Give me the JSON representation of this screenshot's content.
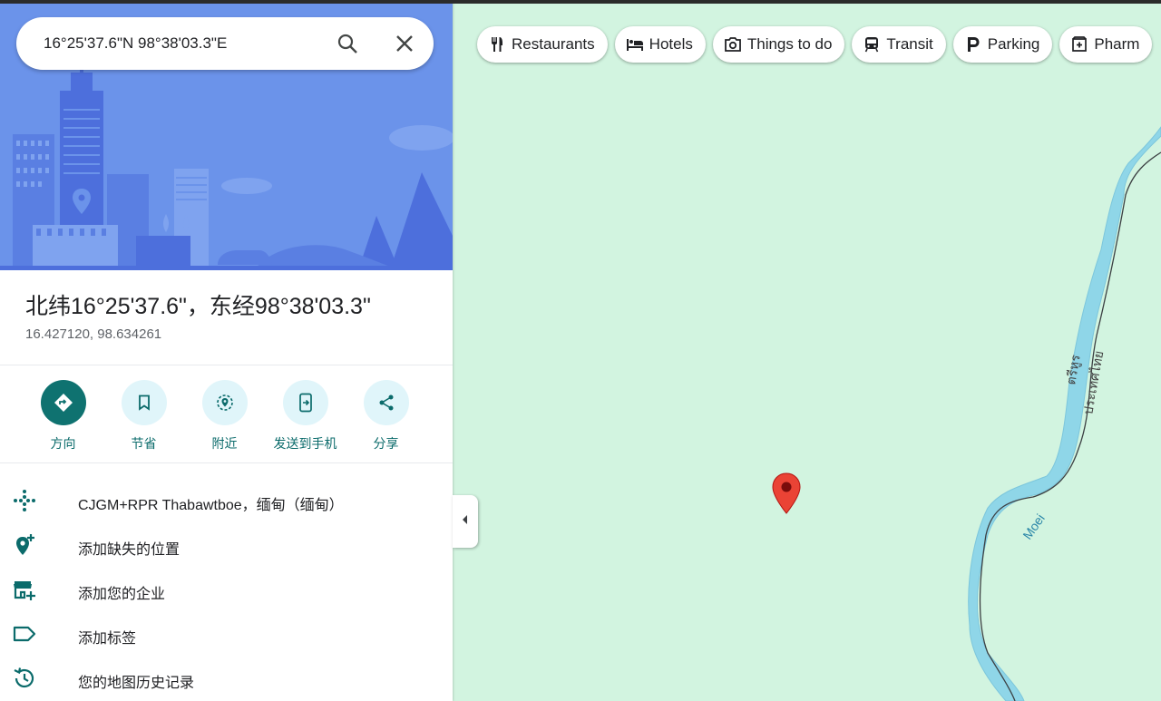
{
  "search": {
    "value": "16°25'37.6\"N 98°38'03.3\"E"
  },
  "place": {
    "title": "北纬16°25'37.6\"，东经98°38'03.3\"",
    "coords": "16.427120, 98.634261"
  },
  "actions": [
    {
      "label": "方向",
      "icon": "directions-icon"
    },
    {
      "label": "节省",
      "icon": "bookmark-icon"
    },
    {
      "label": "附近",
      "icon": "nearby-icon"
    },
    {
      "label": "发送到手机",
      "icon": "send-to-phone-icon"
    },
    {
      "label": "分享",
      "icon": "share-icon"
    }
  ],
  "info_rows": [
    {
      "text": "CJGM+RPR Thabawtboe，缅甸（缅甸）",
      "icon": "plus-code-icon"
    },
    {
      "text": "添加缺失的位置",
      "icon": "add-place-icon"
    },
    {
      "text": "添加您的企业",
      "icon": "add-business-icon"
    },
    {
      "text": "添加标签",
      "icon": "label-icon"
    },
    {
      "text": "您的地图历史记录",
      "icon": "history-icon"
    }
  ],
  "categories": [
    {
      "label": "Restaurants",
      "icon": "restaurant-icon"
    },
    {
      "label": "Hotels",
      "icon": "hotel-icon"
    },
    {
      "label": "Things to do",
      "icon": "camera-icon"
    },
    {
      "label": "Transit",
      "icon": "transit-icon"
    },
    {
      "label": "Parking",
      "icon": "parking-icon"
    },
    {
      "label": "Pharm",
      "icon": "pharmacy-icon"
    }
  ],
  "map_labels": {
    "river": "Moei",
    "thai_label_1": "ประเทศไทย",
    "thai_label_2": "ตรีหูร"
  },
  "colors": {
    "accent": "#0f7270",
    "land": "#d2f4e0",
    "water": "#8fd6e8",
    "hero": "#6b93ea",
    "pin": "#ea4335"
  }
}
